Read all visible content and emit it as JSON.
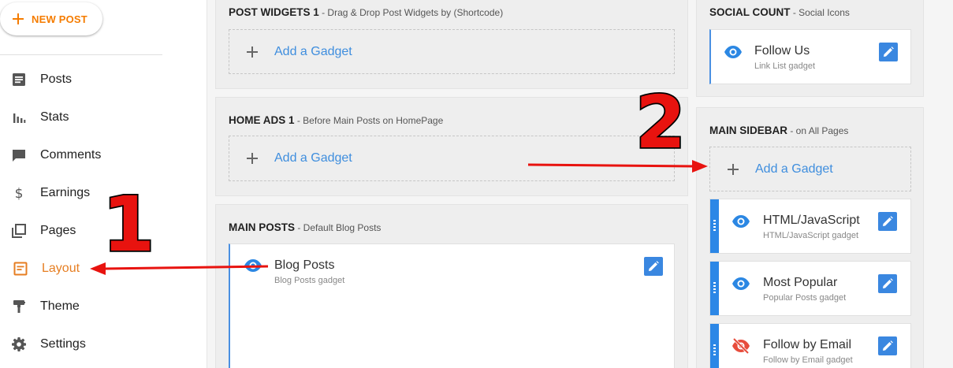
{
  "sidebar": {
    "new_post_label": "NEW POST",
    "items": [
      {
        "label": "Posts",
        "icon": "posts-icon"
      },
      {
        "label": "Stats",
        "icon": "stats-icon"
      },
      {
        "label": "Comments",
        "icon": "comments-icon"
      },
      {
        "label": "Earnings",
        "icon": "earnings-icon"
      },
      {
        "label": "Pages",
        "icon": "pages-icon"
      },
      {
        "label": "Layout",
        "icon": "layout-icon",
        "active": true
      },
      {
        "label": "Theme",
        "icon": "theme-icon"
      },
      {
        "label": "Settings",
        "icon": "settings-icon"
      }
    ],
    "accent_color": "#e67e22"
  },
  "layout": {
    "add_gadget_label": "Add a Gadget",
    "post_widgets": {
      "title": "POST WIDGETS 1",
      "subtitle": " - Drag & Drop Post Widgets by (Shortcode)"
    },
    "home_ads": {
      "title": "HOME ADS 1",
      "subtitle": " - Before Main Posts on HomePage"
    },
    "main_posts": {
      "title": "MAIN POSTS",
      "subtitle": " - Default Blog Posts",
      "gadgets": [
        {
          "title": "Blog Posts",
          "subtitle": "Blog Posts gadget",
          "icon": "eye-icon"
        }
      ]
    },
    "social_count": {
      "title": "SOCIAL COUNT",
      "subtitle": " - Social Icons",
      "gadgets": [
        {
          "title": "Follow Us",
          "subtitle": "Link List gadget",
          "icon": "eye-icon"
        }
      ]
    },
    "main_sidebar": {
      "title": "MAIN SIDEBAR",
      "subtitle": " - on All Pages",
      "gadgets": [
        {
          "title": "HTML/JavaScript",
          "subtitle": "HTML/JavaScript gadget",
          "icon": "eye-icon"
        },
        {
          "title": "Most Popular",
          "subtitle": "Popular Posts gadget",
          "icon": "eye-icon"
        },
        {
          "title": "Follow by Email",
          "subtitle": "Follow by Email gadget",
          "icon": "eye-off-icon"
        }
      ]
    }
  },
  "annotations": {
    "step1": "1",
    "step2": "2",
    "color": "#e8130f"
  },
  "colors": {
    "link_blue": "#3f8ede",
    "edit_button": "#3a87e0",
    "handle_blue": "#2c87e6",
    "hidden_red": "#e74c3c"
  }
}
